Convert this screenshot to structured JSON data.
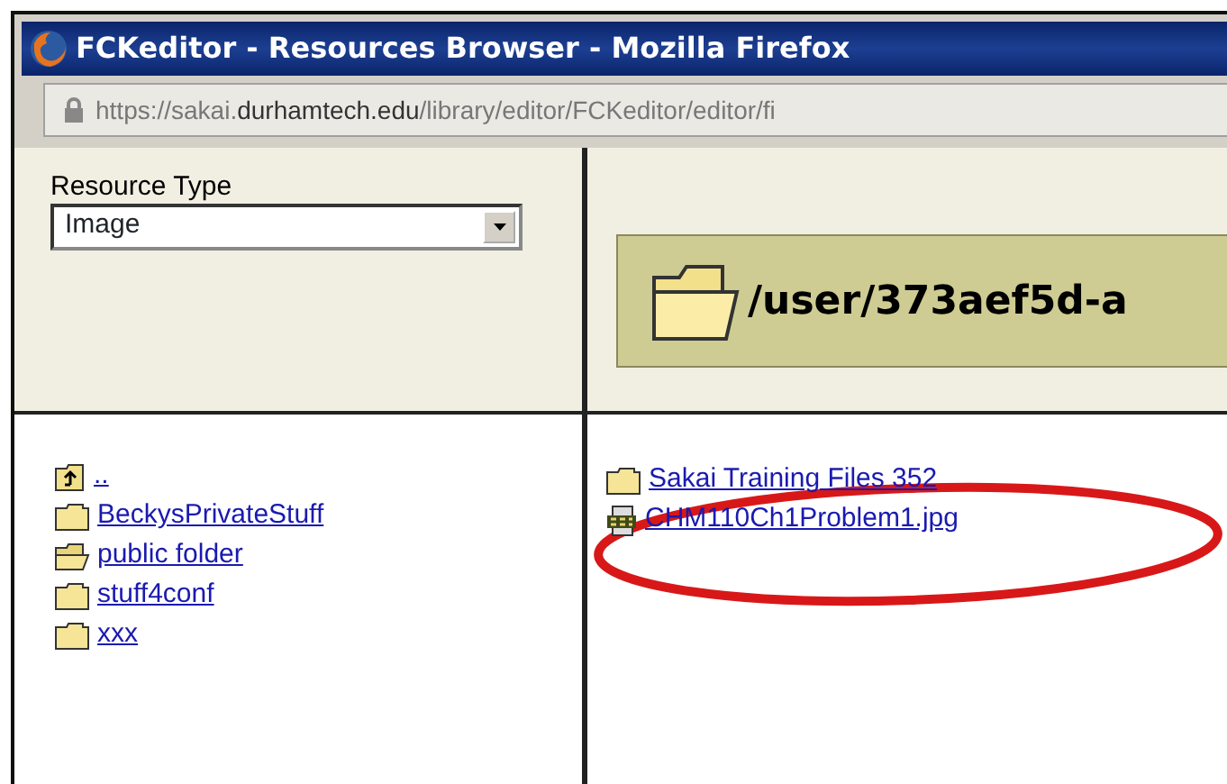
{
  "window": {
    "title": "FCKeditor - Resources Browser - Mozilla Firefox"
  },
  "address_bar": {
    "url": "https://sakai.**durhamtech.edu**/library/editor/FCKeditor/editor/fi"
  },
  "resource_type": {
    "label": "Resource Type",
    "value": "Image"
  },
  "folder_tree": [
    {
      "kind": "up",
      "name": ".."
    },
    {
      "kind": "folder",
      "name": "BeckysPrivateStuff"
    },
    {
      "kind": "open-folder",
      "name": "public folder"
    },
    {
      "kind": "folder",
      "name": "stuff4conf"
    },
    {
      "kind": "folder",
      "name": "xxx"
    }
  ],
  "current_folder": {
    "path": "/user/373aef5d-a"
  },
  "files": [
    {
      "kind": "folder",
      "name": "Sakai Training Files 352",
      "circled": false
    },
    {
      "kind": "image",
      "name": "CHM110Ch1Problem1.jpg",
      "circled": true
    }
  ]
}
